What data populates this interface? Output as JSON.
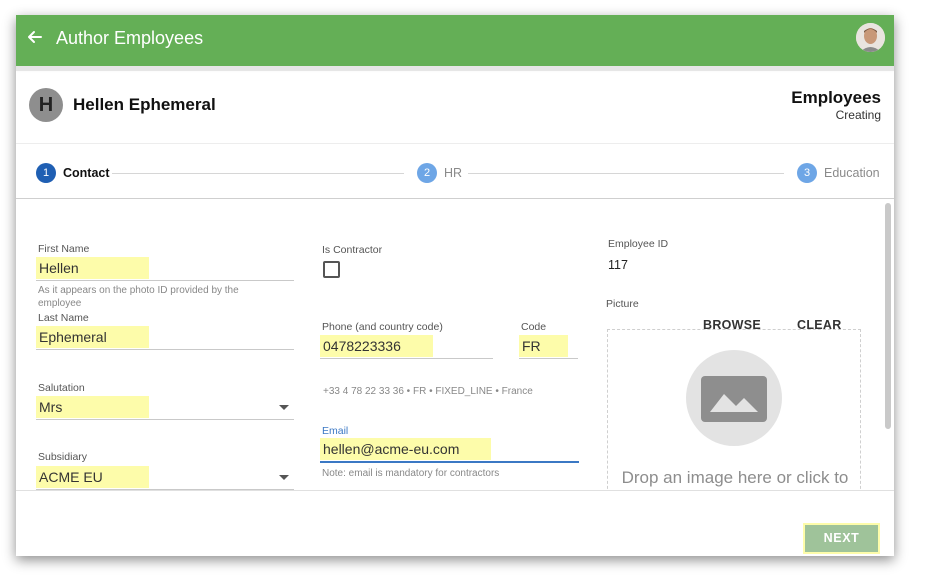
{
  "app": {
    "title": "Author Employees"
  },
  "record": {
    "initial": "H",
    "name": "Hellen Ephemeral",
    "entity": "Employees",
    "state": "Creating"
  },
  "steps": [
    {
      "number": "1",
      "label": "Contact",
      "state": "active"
    },
    {
      "number": "2",
      "label": "HR",
      "state": "inactive"
    },
    {
      "number": "3",
      "label": "Education",
      "state": "inactive"
    }
  ],
  "form": {
    "first_name": {
      "label": "First Name",
      "value": "Hellen",
      "helper": "As it appears on the photo ID provided by the employee"
    },
    "last_name": {
      "label": "Last Name",
      "value": "Ephemeral"
    },
    "salutation": {
      "label": "Salutation",
      "value": "Mrs"
    },
    "subsidiary": {
      "label": "Subsidiary",
      "value": "ACME EU"
    },
    "is_contractor": {
      "label": "Is Contractor",
      "checked": false
    },
    "phone": {
      "label": "Phone (and country code)",
      "value": "0478223336",
      "helper": "+33 4 78 22 33 36 • FR • FIXED_LINE • France"
    },
    "code": {
      "label": "Code",
      "value": "FR"
    },
    "email": {
      "label": "Email",
      "value": "hellen@acme-eu.com",
      "helper": "Note: email is mandatory for contractors"
    },
    "employee_id": {
      "label": "Employee ID",
      "value": "117"
    },
    "picture": {
      "label": "Picture",
      "browse_label": "BROWSE",
      "clear_label": "CLEAR",
      "drop_text": "Drop an image here or click to"
    }
  },
  "footer": {
    "next_label": "NEXT"
  },
  "colors": {
    "appbar": "#64af56",
    "step_active": "#1f5fb3",
    "step_inactive": "#6ea6e6",
    "highlight": "#fdfcaa",
    "email_accent": "#3b78c4",
    "next_button": "#9fc39a"
  },
  "icons": {
    "back": "arrow-left-icon",
    "avatar": "user-avatar",
    "caret": "dropdown-caret-icon",
    "image": "image-placeholder-icon"
  }
}
